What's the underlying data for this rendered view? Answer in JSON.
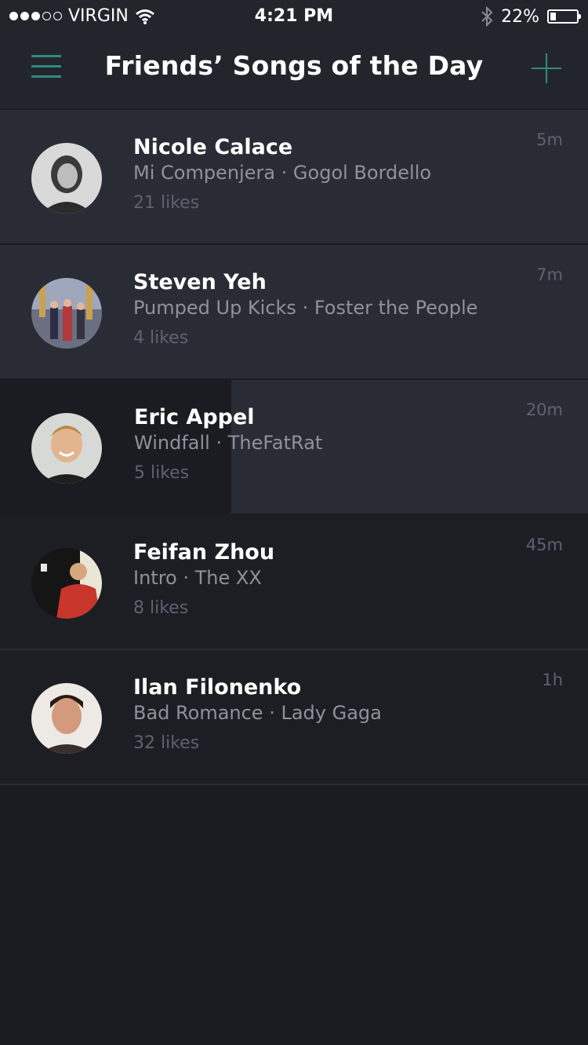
{
  "status_bar": {
    "carrier": "VIRGIN",
    "time": "4:21 PM",
    "battery_text": "22%",
    "battery_level": 0.22,
    "signal_bars_filled": 3,
    "signal_bars_total": 5
  },
  "header": {
    "title": "Friends’ Songs of the Day",
    "accent_color": "#2f8a7d"
  },
  "feed": [
    {
      "name": "Nicole Calace",
      "song": "Mi Compenjera · Gogol Bordello",
      "likes": "21 likes",
      "time": "5m",
      "avatar_icon": "woman-portrait"
    },
    {
      "name": "Steven Yeh",
      "song": "Pumped Up Kicks · Foster the People",
      "likes": "4 likes",
      "time": "7m",
      "avatar_icon": "group-photo"
    },
    {
      "name": "Eric Appel",
      "song": "Windfall · TheFatRat",
      "likes": "5 likes",
      "time": "20m",
      "avatar_icon": "smiling-man"
    },
    {
      "name": "Feifan Zhou",
      "song": "Intro · The XX",
      "likes": "8 likes",
      "time": "45m",
      "avatar_icon": "man-red-jacket"
    },
    {
      "name": "Ilan Filonenko",
      "song": "Bad Romance · Lady Gaga",
      "likes": "32 likes",
      "time": "1h",
      "avatar_icon": "man-portrait"
    }
  ]
}
